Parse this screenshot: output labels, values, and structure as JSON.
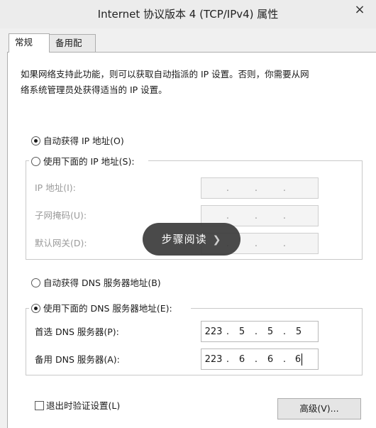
{
  "window": {
    "title": "Internet 协议版本 4 (TCP/IPv4) 属性",
    "close_icon": "close-icon"
  },
  "tabs": [
    {
      "label": "常规",
      "active": true
    },
    {
      "label": "备用配置",
      "active": false
    }
  ],
  "description": {
    "line1": "如果网络支持此功能，则可以获取自动指派的 IP 设置。否则，你需要从网",
    "line2": "络系统管理员处获得适当的 IP 设置。"
  },
  "ip": {
    "auto_label": "自动获得 IP 地址(O)",
    "auto_checked": true,
    "manual_label": "使用下面的 IP 地址(S):",
    "manual_checked": false,
    "fields": [
      {
        "label": "IP 地址(I):",
        "octets": [
          "",
          "",
          "",
          ""
        ]
      },
      {
        "label": "子网掩码(U):",
        "octets": [
          "",
          "",
          "",
          ""
        ]
      },
      {
        "label": "默认网关(D):",
        "octets": [
          "",
          "",
          "",
          ""
        ]
      }
    ]
  },
  "dns": {
    "auto_label": "自动获得 DNS 服务器地址(B)",
    "auto_checked": false,
    "manual_label": "使用下面的 DNS 服务器地址(E):",
    "manual_checked": true,
    "preferred": {
      "label": "首选 DNS 服务器(P):",
      "octets": [
        "223",
        "5",
        "5",
        "5"
      ]
    },
    "alternate": {
      "label": "备用 DNS 服务器(A):",
      "octets": [
        "223",
        "6",
        "6",
        "6"
      ]
    }
  },
  "footer": {
    "validate_label": "退出时验证设置(L)",
    "validate_checked": false,
    "advanced_label": "高级(V)..."
  },
  "overlay": {
    "label": "步骤阅读",
    "icon": "chevron-right-icon"
  }
}
